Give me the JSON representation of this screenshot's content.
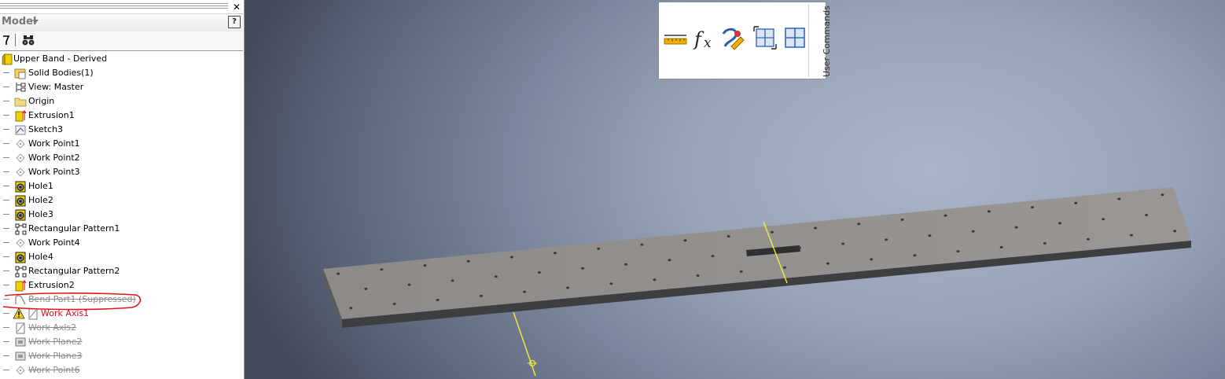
{
  "browser": {
    "title": "Model",
    "help_label": "?",
    "close_label": "✕"
  },
  "tree": [
    {
      "label": "Upper Band - Derived",
      "icon": "derived-part-icon",
      "state": "normal"
    },
    {
      "label": "Solid Bodies(1)",
      "icon": "solid-bodies-icon",
      "state": "normal"
    },
    {
      "label": "View: Master",
      "icon": "view-icon",
      "state": "normal"
    },
    {
      "label": "Origin",
      "icon": "folder-icon",
      "state": "normal"
    },
    {
      "label": "Extrusion1",
      "icon": "extrusion-icon",
      "state": "normal"
    },
    {
      "label": "Sketch3",
      "icon": "sketch-icon",
      "state": "normal"
    },
    {
      "label": "Work Point1",
      "icon": "work-point-icon",
      "state": "normal"
    },
    {
      "label": "Work Point2",
      "icon": "work-point-icon",
      "state": "normal"
    },
    {
      "label": "Work Point3",
      "icon": "work-point-icon",
      "state": "normal"
    },
    {
      "label": "Hole1",
      "icon": "hole-icon",
      "state": "normal"
    },
    {
      "label": "Hole2",
      "icon": "hole-icon",
      "state": "normal"
    },
    {
      "label": "Hole3",
      "icon": "hole-icon",
      "state": "normal"
    },
    {
      "label": "Rectangular Pattern1",
      "icon": "rectangular-pattern-icon",
      "state": "normal"
    },
    {
      "label": "Work Point4",
      "icon": "work-point-icon",
      "state": "normal"
    },
    {
      "label": "Hole4",
      "icon": "hole-icon",
      "state": "normal"
    },
    {
      "label": "Rectangular Pattern2",
      "icon": "rectangular-pattern-icon",
      "state": "normal"
    },
    {
      "label": "Extrusion2",
      "icon": "extrusion-icon",
      "state": "normal"
    },
    {
      "label": "Bend Part1 (Suppressed)",
      "icon": "bend-part-icon",
      "state": "suppressed"
    },
    {
      "label": "Work Axis1",
      "icon": "work-axis-icon",
      "state": "error"
    },
    {
      "label": "Work Axis2",
      "icon": "work-axis-icon",
      "state": "suppressed"
    },
    {
      "label": "Work Plane2",
      "icon": "work-plane-icon",
      "state": "suppressed"
    },
    {
      "label": "Work Plane3",
      "icon": "work-plane-icon",
      "state": "suppressed"
    },
    {
      "label": "Work Point6",
      "icon": "work-point-icon",
      "state": "suppressed"
    }
  ],
  "user_commands": {
    "title": "User Commands",
    "buttons": [
      "measure-icon",
      "parameters-fx-icon",
      "appearance-icon",
      "split-view-icon",
      "grid-view-icon"
    ]
  },
  "colors": {
    "highlight_circle": "#e8141c",
    "axis_line": "#f2ec38",
    "error_text": "#c8101c",
    "suppressed_text": "#8a8a8a"
  }
}
